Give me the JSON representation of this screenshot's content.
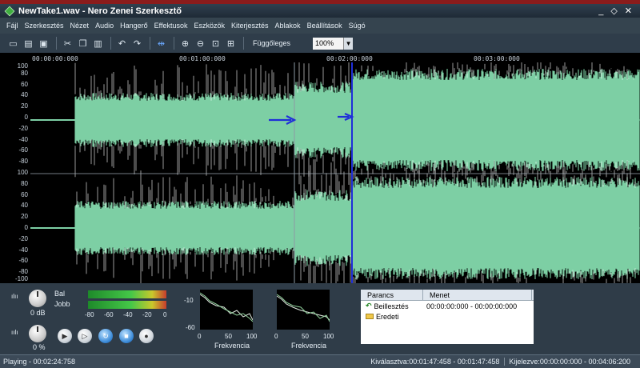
{
  "window": {
    "title": "NewTake1.wav - Nero Zenei Szerkesztő"
  },
  "window_buttons": {
    "minimize": "_",
    "restore": "◇",
    "close": "✕"
  },
  "menu": [
    "Fájl",
    "Szerkesztés",
    "Nézet",
    "Audio",
    "Hangerő",
    "Effektusok",
    "Eszközök",
    "Kiterjesztés",
    "Ablakok",
    "Beállítások",
    "Súgó"
  ],
  "toolbar": {
    "view_label": "Függőleges",
    "zoom_value": "100%"
  },
  "ruler": {
    "labels": [
      "00:00:00:000",
      "00:01:00:000",
      "00:02:00:000",
      "00:03:00:000"
    ]
  },
  "y_axis": {
    "labels": [
      "100",
      "80",
      "60",
      "40",
      "20",
      "0",
      "-20",
      "-40",
      "-60",
      "-80",
      "100",
      "80",
      "60",
      "40",
      "20",
      "0",
      "-20",
      "-40",
      "-60",
      "-80",
      "-100"
    ]
  },
  "volume": {
    "left_label": "Bal",
    "right_label": "Jobb",
    "db_value": "0 dB",
    "pan_value": "0 %",
    "meter_ticks": [
      "-80",
      "-60",
      "-40",
      "-20",
      "0"
    ]
  },
  "frequency": {
    "y_ticks": [
      "-10",
      "-60"
    ],
    "x_ticks": [
      "0",
      "50",
      "100"
    ],
    "caption": "Frekvencia"
  },
  "history": {
    "col_command": "Parancs",
    "col_progress": "Menet",
    "rows": [
      {
        "command": "Beillesztés",
        "progress": "00:00:00:000 - 00:00:00:000"
      },
      {
        "command": "Eredeti",
        "progress": ""
      }
    ]
  },
  "status": {
    "left": "Playing - 00:02:24:758",
    "selected": "Kiválasztva:00:01:47:458 - 00:01:47:458",
    "visible": "Kijelezve:00:00:00:000 - 00:04:06:200"
  },
  "colors": {
    "waveform": "#7dcfa4",
    "cursor": "#1f2fd8",
    "background": "#000000"
  }
}
